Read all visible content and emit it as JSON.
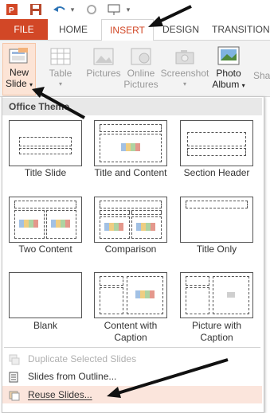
{
  "tabs": {
    "file": "FILE",
    "home": "HOME",
    "insert": "INSERT",
    "design": "DESIGN",
    "transitions": "TRANSITION"
  },
  "ribbon": {
    "new_slide_line1": "New",
    "new_slide_line2": "Slide",
    "table": "Table",
    "pictures": "Pictures",
    "online_line1": "Online",
    "online_line2": "Pictures",
    "screenshot": "Screenshot",
    "photo_line1": "Photo",
    "photo_line2": "Album",
    "shapes": "Sha"
  },
  "menu": {
    "header": "Office Theme",
    "layouts": [
      {
        "label1": "Title Slide",
        "label2": ""
      },
      {
        "label1": "Title and Content",
        "label2": ""
      },
      {
        "label1": "Section Header",
        "label2": ""
      },
      {
        "label1": "Two Content",
        "label2": ""
      },
      {
        "label1": "Comparison",
        "label2": ""
      },
      {
        "label1": "Title Only",
        "label2": ""
      },
      {
        "label1": "Blank",
        "label2": ""
      },
      {
        "label1": "Content with",
        "label2": "Caption"
      },
      {
        "label1": "Picture with",
        "label2": "Caption"
      }
    ],
    "duplicate": "Duplicate Selected Slides",
    "outline": "Slides from Outline...",
    "reuse": "Reuse Slides..."
  }
}
